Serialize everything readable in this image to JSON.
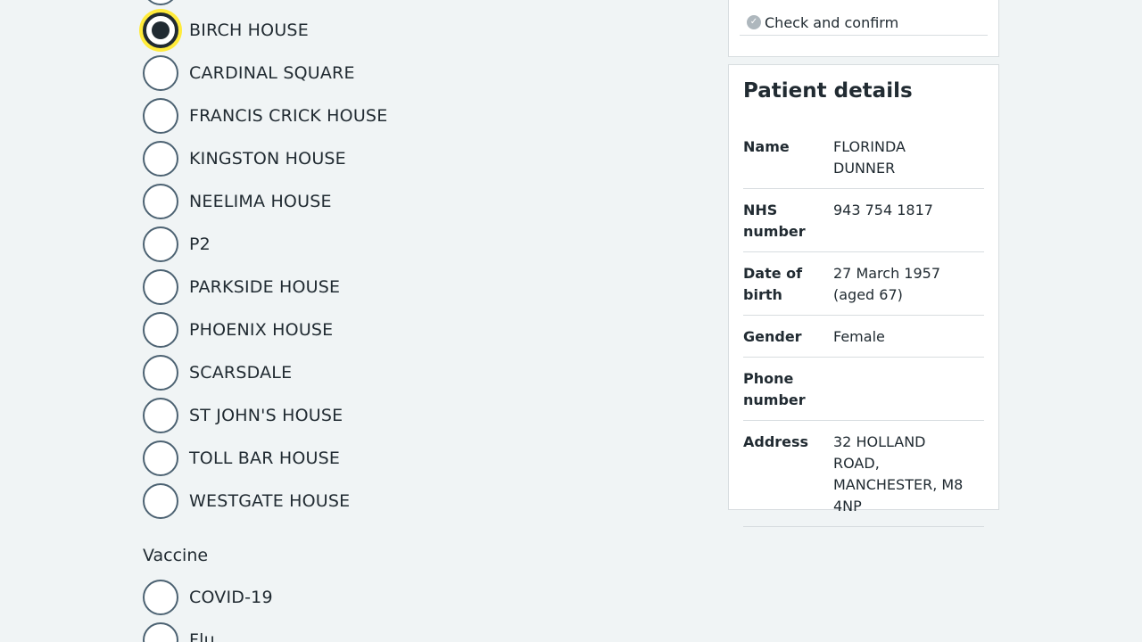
{
  "location_options": [
    {
      "label": "",
      "checked": false
    },
    {
      "label": "BIRCH HOUSE",
      "checked": true
    },
    {
      "label": "CARDINAL SQUARE",
      "checked": false
    },
    {
      "label": "FRANCIS CRICK HOUSE",
      "checked": false
    },
    {
      "label": "KINGSTON HOUSE",
      "checked": false
    },
    {
      "label": "NEELIMA HOUSE",
      "checked": false
    },
    {
      "label": "P2",
      "checked": false
    },
    {
      "label": "PARKSIDE HOUSE",
      "checked": false
    },
    {
      "label": "PHOENIX HOUSE",
      "checked": false
    },
    {
      "label": "SCARSDALE",
      "checked": false
    },
    {
      "label": "ST JOHN'S HOUSE",
      "checked": false
    },
    {
      "label": "TOLL BAR HOUSE",
      "checked": false
    },
    {
      "label": "WESTGATE HOUSE",
      "checked": false
    }
  ],
  "vaccine": {
    "legend": "Vaccine",
    "options": [
      {
        "label": "COVID-19",
        "checked": false
      },
      {
        "label": "Flu",
        "checked": false
      }
    ]
  },
  "task_list": {
    "item": "Check and confirm",
    "icon": "check-circle-icon"
  },
  "patient": {
    "title": "Patient details",
    "rows": [
      {
        "key": "Name",
        "value": "FLORINDA DUNNER"
      },
      {
        "key": "NHS number",
        "value": "943 754 1817"
      },
      {
        "key": "Date of birth",
        "value": "27 March 1957 (aged 67)"
      },
      {
        "key": "Gender",
        "value": "Female"
      },
      {
        "key": "Phone number",
        "value": ""
      },
      {
        "key": "Address",
        "value": "32 HOLLAND ROAD, MANCHESTER, M8 4NP"
      }
    ]
  }
}
